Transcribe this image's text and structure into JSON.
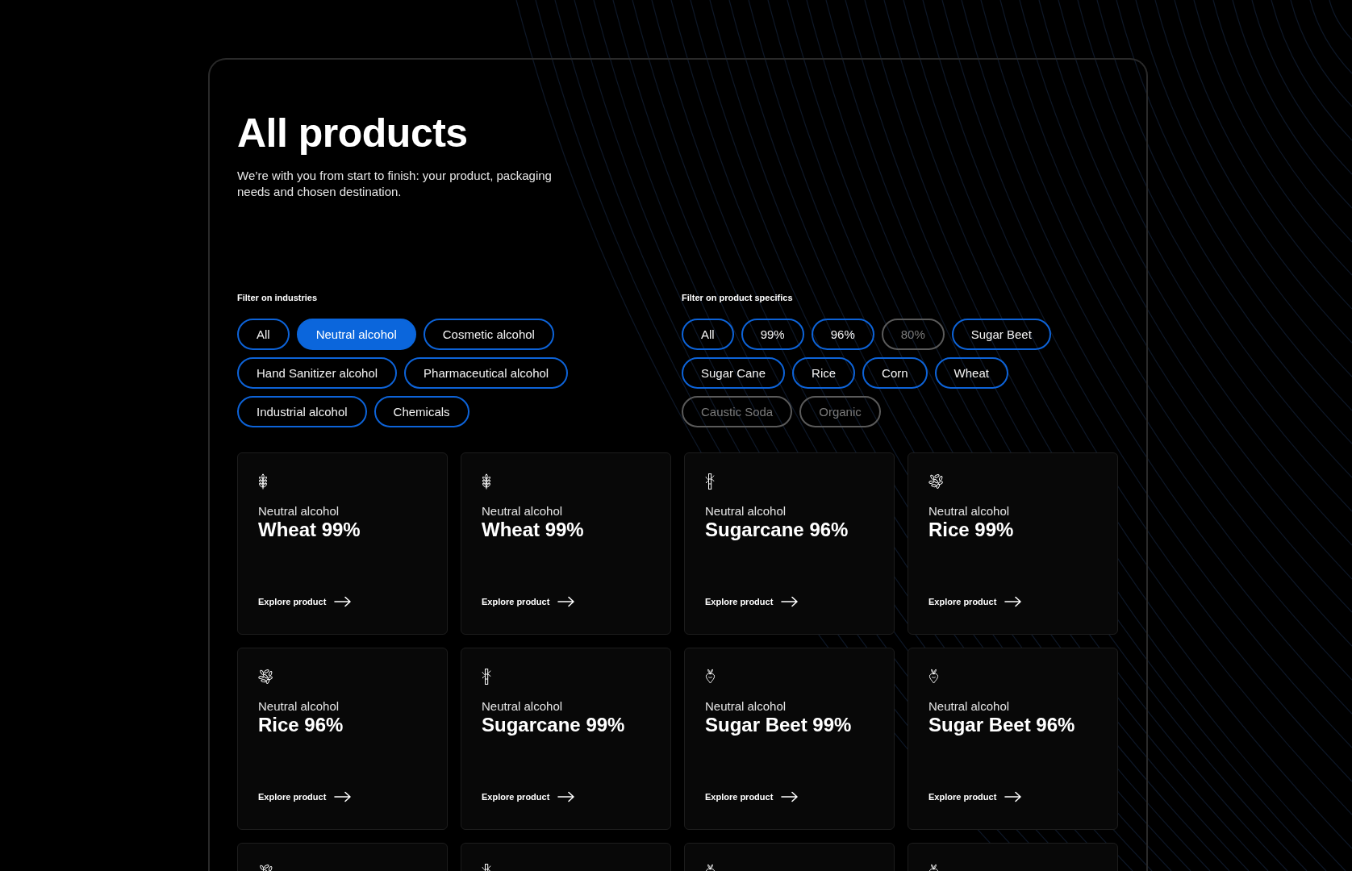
{
  "page": {
    "title": "All products",
    "intro": "We’re with you from start to finish: your product, packaging needs and chosen destination."
  },
  "filters": [
    {
      "label": "Filter on industries",
      "options": [
        {
          "label": "All",
          "selected": false,
          "disabled": false
        },
        {
          "label": "Neutral alcohol",
          "selected": true,
          "disabled": false
        },
        {
          "label": "Cosmetic alcohol",
          "selected": false,
          "disabled": false
        },
        {
          "label": "Hand Sanitizer alcohol",
          "selected": false,
          "disabled": false
        },
        {
          "label": "Pharmaceutical alcohol",
          "selected": false,
          "disabled": false
        },
        {
          "label": "Industrial alcohol",
          "selected": false,
          "disabled": false
        },
        {
          "label": "Chemicals",
          "selected": false,
          "disabled": false
        }
      ]
    },
    {
      "label": "Filter on product specifics",
      "options": [
        {
          "label": "All",
          "selected": false,
          "disabled": false
        },
        {
          "label": "99%",
          "selected": false,
          "disabled": false
        },
        {
          "label": "96%",
          "selected": false,
          "disabled": false
        },
        {
          "label": "80%",
          "selected": false,
          "disabled": true
        },
        {
          "label": "Sugar Beet",
          "selected": false,
          "disabled": false
        },
        {
          "label": "Sugar Cane",
          "selected": false,
          "disabled": false
        },
        {
          "label": "Rice",
          "selected": false,
          "disabled": false
        },
        {
          "label": "Corn",
          "selected": false,
          "disabled": false
        },
        {
          "label": "Wheat",
          "selected": false,
          "disabled": false
        },
        {
          "label": "Caustic Soda",
          "selected": false,
          "disabled": true
        },
        {
          "label": "Organic",
          "selected": false,
          "disabled": true
        }
      ]
    }
  ],
  "products": [
    {
      "kind": "wheat",
      "category": "Neutral alcohol",
      "name": "Wheat 99%",
      "link": "Explore product"
    },
    {
      "kind": "wheat",
      "category": "Neutral alcohol",
      "name": "Wheat 99%",
      "link": "Explore product"
    },
    {
      "kind": "sugarcane",
      "category": "Neutral alcohol",
      "name": "Sugarcane 96%",
      "link": "Explore product"
    },
    {
      "kind": "rice",
      "category": "Neutral alcohol",
      "name": "Rice 99%",
      "link": "Explore product"
    },
    {
      "kind": "rice",
      "category": "Neutral alcohol",
      "name": "Rice 96%",
      "link": "Explore product"
    },
    {
      "kind": "sugarcane",
      "category": "Neutral alcohol",
      "name": "Sugarcane 99%",
      "link": "Explore product"
    },
    {
      "kind": "beet",
      "category": "Neutral alcohol",
      "name": "Sugar Beet 99%",
      "link": "Explore product"
    },
    {
      "kind": "beet",
      "category": "Neutral alcohol",
      "name": "Sugar Beet 96%",
      "link": "Explore product"
    },
    {
      "kind": "rice"
    },
    {
      "kind": "sugarcane"
    },
    {
      "kind": "beet"
    },
    {
      "kind": "beet"
    }
  ]
}
